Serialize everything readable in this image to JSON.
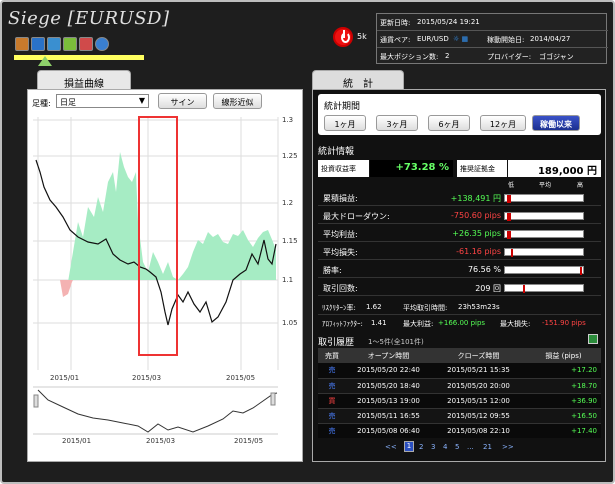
{
  "header": {
    "title": "Siege [EURUSD]",
    "sk_label": "5k",
    "info": {
      "updated_label": "更新日時:",
      "updated_value": "2015/05/24 19:21",
      "pair_label": "通貨ペア:",
      "pair_value": "EUR/USD",
      "started_label": "稼動開始日:",
      "started_value": "2014/04/27",
      "maxpos_label": "最大ポジション数:",
      "maxpos_value": "2",
      "provider_label": "プロバイダー:",
      "provider_value": "ゴゴジャン"
    }
  },
  "tabs": {
    "left": "損益曲線",
    "right": "統　計"
  },
  "left": {
    "type_label": "足種:",
    "type_value": "日足",
    "btn_sine": "サイン",
    "btn_linear": "線形近似",
    "yaxis": [
      "1.3",
      "1.25",
      "1.2",
      "1.15",
      "1.1",
      "1.05"
    ],
    "xaxis": [
      "2015/01",
      "2015/03",
      "2015/05"
    ],
    "nav_xaxis": [
      "2015/01",
      "2015/03",
      "2015/05"
    ]
  },
  "stats": {
    "period_title": "統計期間",
    "periods": [
      "1ヶ月",
      "3ヶ月",
      "6ヶ月",
      "12ヶ月",
      "稼働以来"
    ],
    "info_title": "統計情報",
    "rate_label": "投資収益率",
    "rate_value": "+73.28 %",
    "margin_label": "推奨証拠金",
    "margin_value": "189,000 円",
    "meter_heads": [
      "低",
      "平均",
      "高"
    ],
    "rows": [
      {
        "label": "累積損益:",
        "value": "+138,491 円",
        "color": "#5f5"
      },
      {
        "label": "最大ドローダウン:",
        "value": "-750.60 pips",
        "color": "#f44"
      },
      {
        "label": "平均利益:",
        "value": "+26.35 pips",
        "color": "#5f5"
      },
      {
        "label": "平均損失:",
        "value": "-61.16 pips",
        "color": "#f44"
      },
      {
        "label": "勝率:",
        "value": "76.56 %",
        "color": "#fff"
      },
      {
        "label": "取引回数:",
        "value": "209 回",
        "color": "#fff"
      }
    ],
    "extra1": {
      "l1": "ﾘｽｸﾘﾀｰﾝ率:",
      "v1": "1.62",
      "l2": "平均取引時間:",
      "v2": "23h53m23s"
    },
    "extra2": {
      "l1": "ｱﾛﾌｨｯﾄﾌｧｸﾀｰ:",
      "v1": "1.41",
      "l2": "最大利益:",
      "v2": "+166.00 pips",
      "l3": "最大損失:",
      "v3": "-151.90 pips"
    }
  },
  "history": {
    "title": "取引履歴",
    "range": "1〜5件(全101件)",
    "headers": [
      "売買",
      "オープン時間",
      "クローズ時間",
      "損益 (pips)"
    ],
    "rows": [
      {
        "side": "売",
        "open": "2015/05/20 22:40",
        "close": "2015/05/21 15:35",
        "pl": "+17.20"
      },
      {
        "side": "売",
        "open": "2015/05/20 18:40",
        "close": "2015/05/20 20:00",
        "pl": "+18.70"
      },
      {
        "side": "買",
        "open": "2015/05/13 19:00",
        "close": "2015/05/15 12:00",
        "pl": "+36.90"
      },
      {
        "side": "売",
        "open": "2015/05/11 16:55",
        "close": "2015/05/12 09:55",
        "pl": "+16.50"
      },
      {
        "side": "売",
        "open": "2015/05/08 06:40",
        "close": "2015/05/08 22:10",
        "pl": "+17.40"
      }
    ],
    "pager": {
      "prev": "<<",
      "pages": [
        "1",
        "2",
        "3",
        "4",
        "5",
        "...",
        "21"
      ],
      "next": ">>"
    }
  }
}
